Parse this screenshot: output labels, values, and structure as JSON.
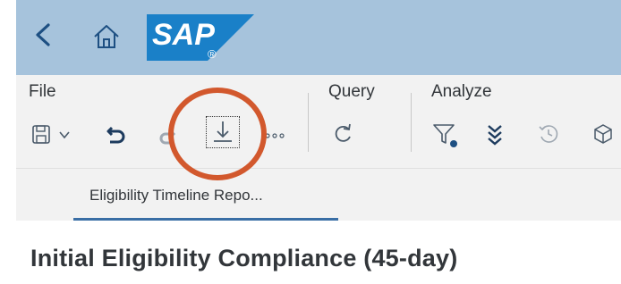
{
  "shell": {
    "logo_text": "SAP",
    "logo_mark": "®",
    "colors": {
      "shellbar": "#a6c3dc",
      "logo": "#1a80c8"
    }
  },
  "toolbar": {
    "groups": [
      {
        "label": "File"
      },
      {
        "label": "Query"
      },
      {
        "label": "Analyze"
      }
    ],
    "icons": [
      "save-icon",
      "dropdown-chevron-icon",
      "undo-icon",
      "redo-icon",
      "export-download-icon",
      "more-icon",
      "refresh-icon",
      "filter-icon",
      "collapse-icon",
      "history-icon",
      "cube-icon"
    ]
  },
  "tabs": [
    {
      "label": "Eligibility Timeline Repo..."
    }
  ],
  "page": {
    "title": "Initial Eligibility Compliance (45-day)"
  },
  "annotation": {
    "color": "#d2582d"
  }
}
